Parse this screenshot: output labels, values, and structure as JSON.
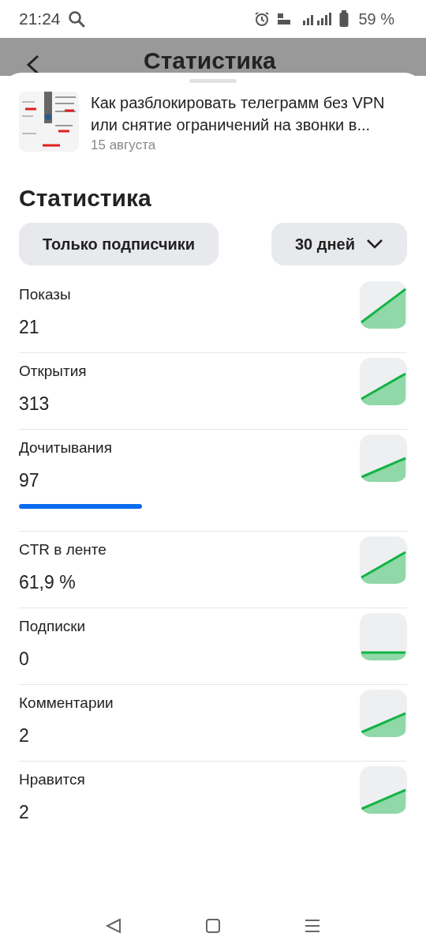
{
  "status_bar": {
    "time": "21:24",
    "battery": "59 %"
  },
  "header": {
    "title": "Статистика"
  },
  "article": {
    "title": "Как разблокировать телеграмм без VPN или снятие ограничений на звонки в...",
    "date": "15 августа"
  },
  "section_title": "Статистика",
  "filters": [
    {
      "label": "Только подписчики",
      "kind": "chip"
    },
    {
      "label": "30 дней",
      "kind": "dropdown"
    }
  ],
  "metrics": [
    {
      "label": "Показы",
      "value": "21",
      "kind": "steep"
    },
    {
      "label": "Открытия",
      "value": "313",
      "kind": "rising"
    },
    {
      "label": "Дочитывания",
      "value": "97",
      "kind": "mild",
      "progress": {
        "level": 0.36
      }
    },
    {
      "label": "CTR в ленте",
      "value": "61,9 %",
      "kind": "rising"
    },
    {
      "label": "Подписки",
      "value": "0",
      "kind": "flat"
    },
    {
      "label": "Комментарии",
      "value": "2",
      "kind": "mild"
    },
    {
      "label": "Нравится",
      "value": "2",
      "kind": "mild"
    }
  ]
}
